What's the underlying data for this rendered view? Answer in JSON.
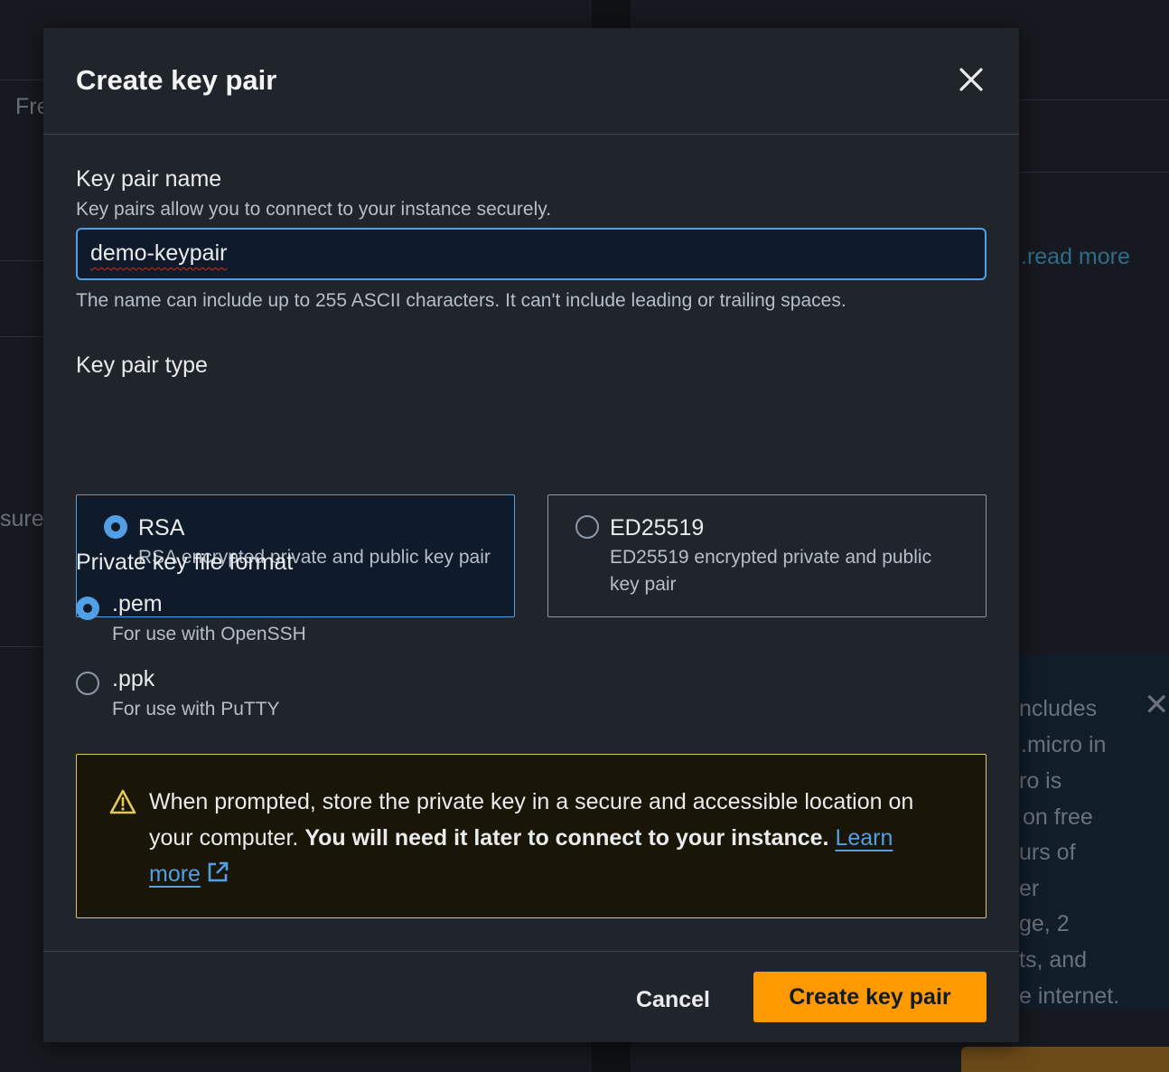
{
  "background": {
    "left_fragments": [
      "Fre",
      "sure"
    ],
    "right_link": ".read more",
    "info_lines": [
      "ncludes",
      ".micro in",
      "ro is",
      "on free",
      "urs of",
      "er",
      "ge, 2",
      "ts, and",
      "e internet."
    ]
  },
  "modal": {
    "title": "Create key pair",
    "close_icon": "close-icon",
    "name_field": {
      "label": "Key pair name",
      "description": "Key pairs allow you to connect to your instance securely.",
      "value": "demo-keypair",
      "constraint": "The name can include up to 255 ASCII characters. It can't include leading or trailing spaces."
    },
    "key_type": {
      "label": "Key pair type",
      "options": [
        {
          "title": "RSA",
          "description": "RSA encrypted private and public key pair",
          "selected": true
        },
        {
          "title": "ED25519",
          "description": "ED25519 encrypted private and public key pair",
          "selected": false
        }
      ]
    },
    "file_format": {
      "label": "Private key file format",
      "options": [
        {
          "label": ".pem",
          "description": "For use with OpenSSH",
          "selected": true
        },
        {
          "label": ".ppk",
          "description": "For use with PuTTY",
          "selected": false
        }
      ]
    },
    "alert": {
      "icon": "warning-icon",
      "text_plain": "When prompted, store the private key in a secure and accessible location on your computer. ",
      "text_bold": "You will need it later to connect to your instance.",
      "link_label": "Learn more",
      "link_icon": "external-link-icon"
    },
    "footer": {
      "cancel_label": "Cancel",
      "submit_label": "Create key pair"
    }
  },
  "colors": {
    "accent": "#539fe5",
    "primary_button": "#ff9900",
    "warning_border": "#e0ca57"
  }
}
